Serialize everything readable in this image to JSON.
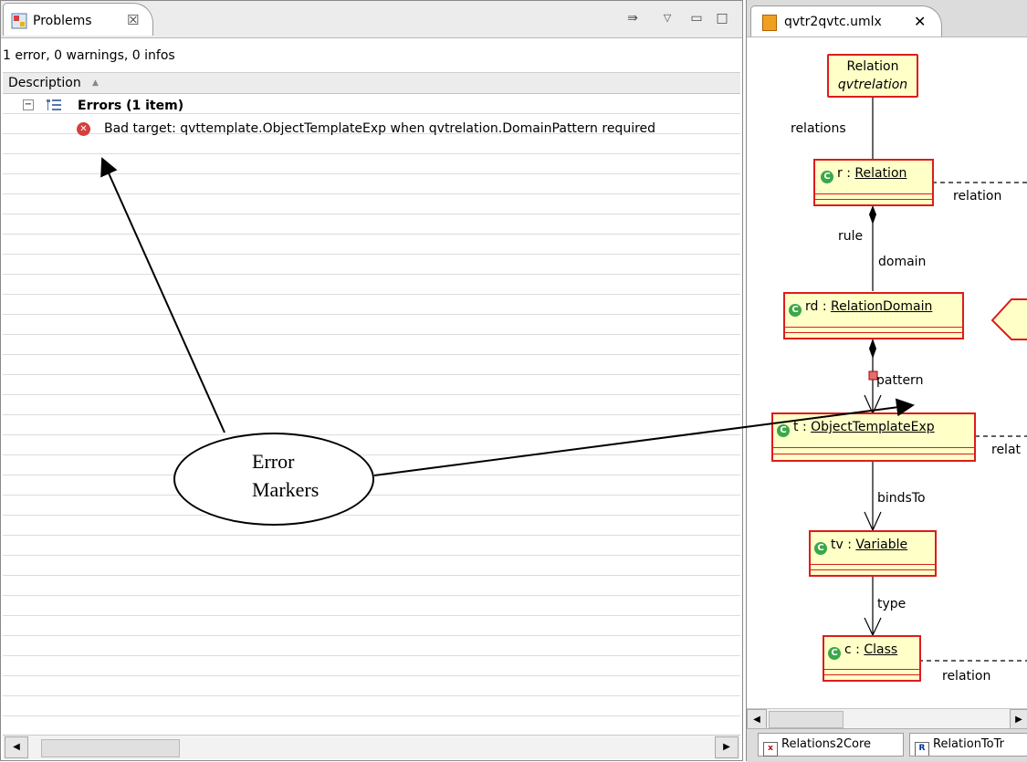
{
  "problems_view": {
    "tab_label": "Problems",
    "tab_close_glyph": "☒",
    "summary": "1 error, 0 warnings, 0 infos",
    "column_header": "Description",
    "groups": [
      {
        "label": "Errors (1 item)",
        "items": [
          {
            "message": "Bad target: qvttemplate.ObjectTemplateExp when qvtrelation.DomainPattern required"
          }
        ]
      }
    ]
  },
  "editor": {
    "tab_label": "qvtr2qvtc.umlx",
    "tab_close_glyph": "✕",
    "diagram": {
      "relation_box": {
        "line1": "Relation",
        "line2": "qvtrelation"
      },
      "nodes": [
        {
          "name": "r",
          "type": "Relation"
        },
        {
          "name": "rd",
          "type": "RelationDomain"
        },
        {
          "name": "t",
          "type": "ObjectTemplateExp"
        },
        {
          "name": "tv",
          "type": "Variable"
        },
        {
          "name": "c",
          "type": "Class"
        }
      ],
      "edge_labels": {
        "relations": "relations",
        "relation_r": "relation",
        "rule": "rule",
        "domain": "domain",
        "pattern": "pattern",
        "relation_t": "relat",
        "binds_to": "bindsTo",
        "type": "type",
        "relation_c": "relation"
      }
    },
    "bottom_tabs": [
      {
        "icon": "x",
        "label": "Relations2Core"
      },
      {
        "icon": "R",
        "label": "RelationToTr"
      }
    ]
  },
  "annotation": {
    "line1": "Error",
    "line2": "Markers"
  },
  "colors": {
    "error_red": "#d24040",
    "uml_border": "#dd1c1c",
    "uml_fill": "#ffffc8",
    "class_icon_green": "#3aa84a"
  }
}
